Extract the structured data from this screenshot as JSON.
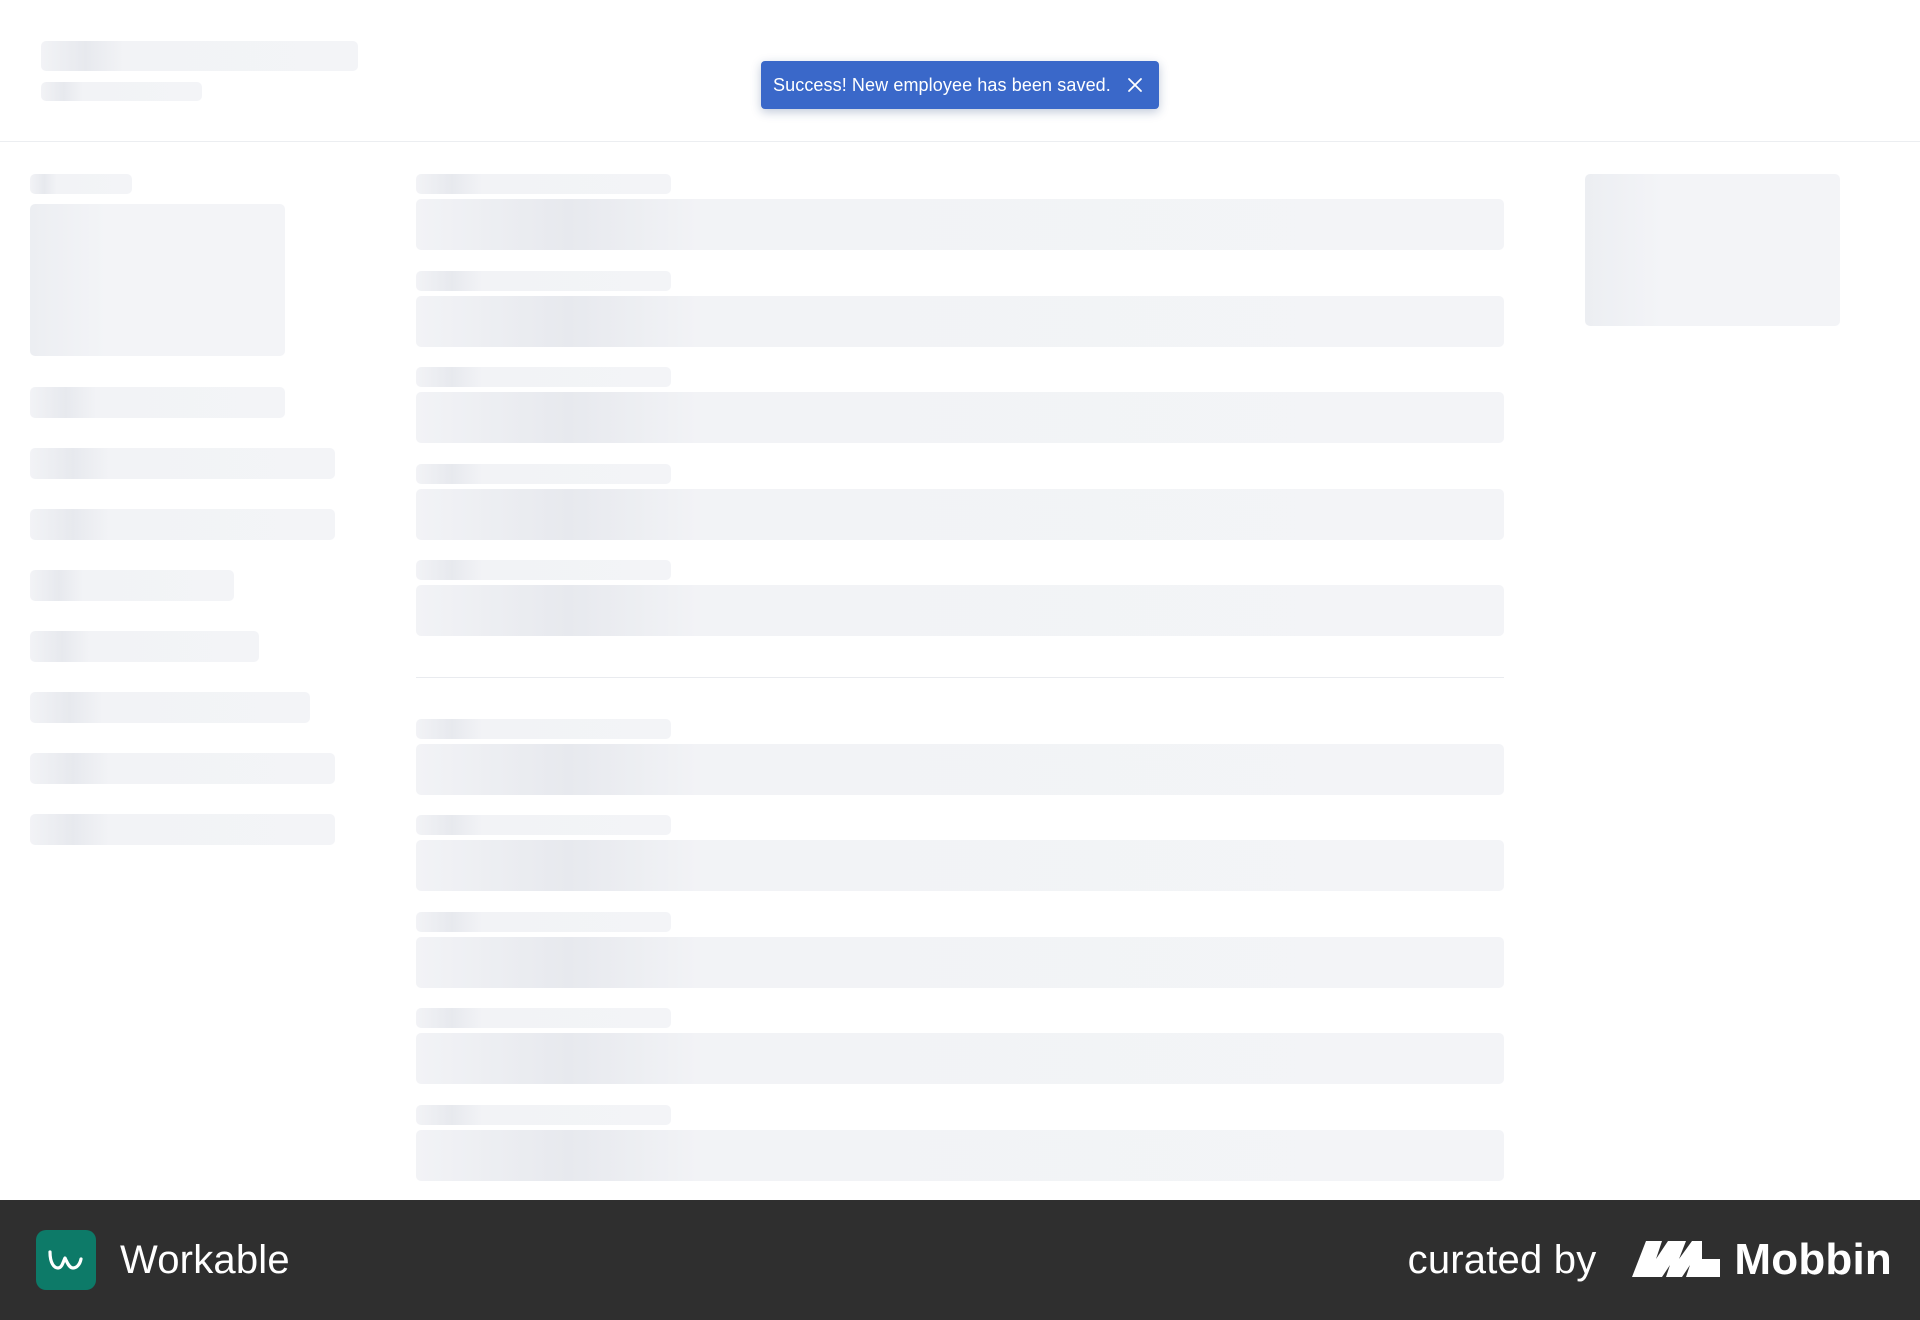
{
  "notification": {
    "message": "Success! New employee has been saved.",
    "close_icon": "close-icon",
    "background": "#3a68c9"
  },
  "footer": {
    "brand_name": "Workable",
    "brand_icon": "workable-logo-icon",
    "brand_color": "#0d7a68",
    "curated_label": "curated by",
    "curator_name": "Mobbin",
    "curator_icon": "mobbin-logo-icon",
    "background": "#2f2f2f"
  },
  "loading_state": {
    "theme_color": "#f1f2f5"
  }
}
